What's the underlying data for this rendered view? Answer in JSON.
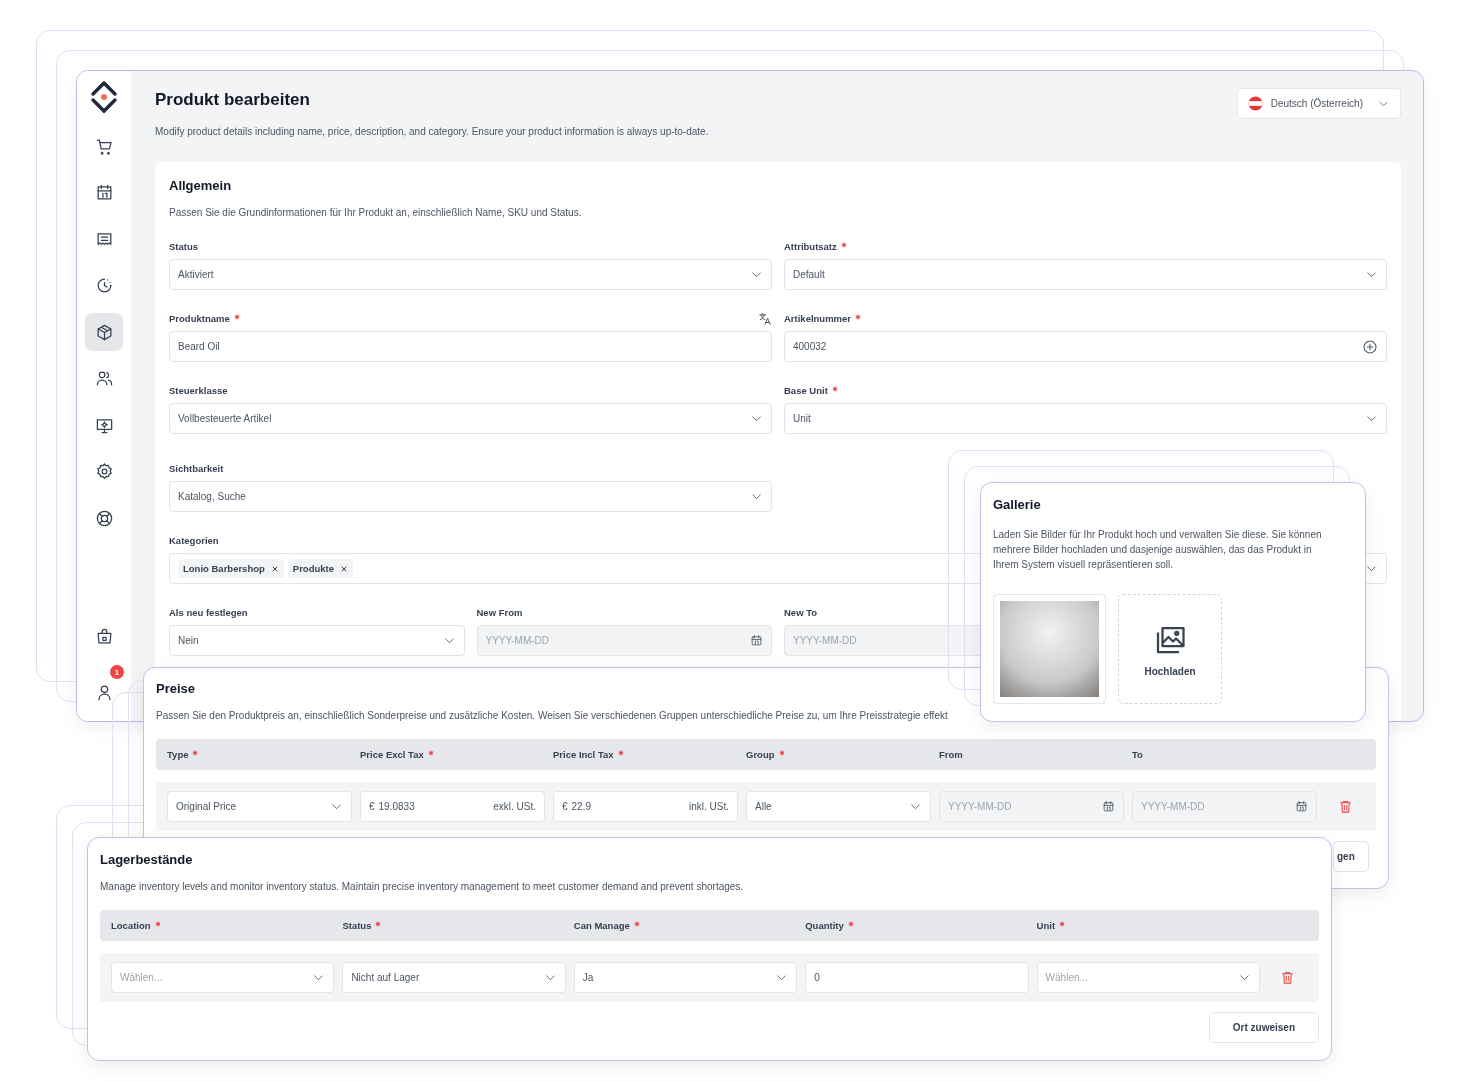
{
  "sidebar": {
    "items": [
      {
        "kind": "cart",
        "selected": false
      },
      {
        "kind": "calendar",
        "selected": false
      },
      {
        "kind": "receipt",
        "selected": false
      },
      {
        "kind": "clock",
        "selected": false
      },
      {
        "kind": "box",
        "selected": true
      },
      {
        "kind": "users",
        "selected": false
      },
      {
        "kind": "monitor",
        "selected": false
      },
      {
        "kind": "gear",
        "selected": false
      },
      {
        "kind": "lifebuoy",
        "selected": false
      }
    ],
    "bottom_items": [
      {
        "kind": "bag",
        "selected": false
      },
      {
        "kind": "user",
        "selected": false,
        "badge": "1"
      }
    ]
  },
  "header": {
    "title": "Produkt bearbeiten",
    "description": "Modify product details including name, price, description, and category. Ensure your product information is always up-to-date.",
    "language": "Deutsch (Österreich)"
  },
  "general": {
    "title": "Allgemein",
    "description": "Passen Sie die Grundinformationen für Ihr Produkt an, einschließlich Name, SKU und Status.",
    "rows": [
      {
        "fields": [
          {
            "label": "Status",
            "required": false,
            "translatable": false,
            "kind": "select",
            "value": "Aktiviert"
          },
          {
            "label": "Attributsatz",
            "required": true,
            "translatable": false,
            "kind": "select",
            "value": "Default"
          }
        ]
      },
      {
        "fields": [
          {
            "label": "Produktname",
            "required": true,
            "translatable": true,
            "kind": "input",
            "value": "Beard Oil"
          },
          {
            "label": "Artikelnummer",
            "required": true,
            "translatable": false,
            "kind": "input-add",
            "value": "400032"
          }
        ]
      },
      {
        "fields": [
          {
            "label": "Steuerklasse",
            "required": false,
            "translatable": false,
            "kind": "select",
            "value": "Vollbesteuerte Artikel"
          },
          {
            "label": "Base Unit",
            "required": true,
            "translatable": false,
            "kind": "select",
            "value": "Unit"
          }
        ]
      },
      {
        "fields": [
          {
            "label": "Sichtbarkeit",
            "required": false,
            "translatable": false,
            "kind": "select",
            "value": "Katalog, Suche"
          }
        ]
      },
      {
        "fields": [
          {
            "label": "Kategorien",
            "required": false,
            "translatable": false,
            "kind": "tags",
            "tags": [
              "Lonio Barbershop",
              "Produkte"
            ]
          }
        ]
      },
      {
        "fields": [
          {
            "label": "Als neu festlegen",
            "required": false,
            "translatable": false,
            "kind": "select",
            "value": "Nein"
          },
          {
            "label": "New From",
            "required": false,
            "translatable": false,
            "kind": "date",
            "placeholder": "YYYY-MM-DD"
          },
          {
            "label": "New To",
            "required": false,
            "translatable": false,
            "kind": "date",
            "placeholder": "YYYY-MM-DD"
          }
        ]
      }
    ]
  },
  "pricing": {
    "title": "Preise",
    "description": "Passen Sie den Produktpreis an, einschließlich Sonderpreise und zusätzliche Kosten. Weisen Sie verschiedenen Gruppen unterschiedliche Preise zu, um Ihre Preisstrategie effekt",
    "columns": [
      {
        "label": "Type",
        "required": true
      },
      {
        "label": "Price Excl Tax",
        "required": true
      },
      {
        "label": "Price Incl Tax",
        "required": true
      },
      {
        "label": "Group",
        "required": true
      },
      {
        "label": "From",
        "required": false
      },
      {
        "label": "To",
        "required": false
      }
    ],
    "rows": [
      {
        "cells": [
          {
            "kind": "select",
            "value": "Original Price"
          },
          {
            "kind": "money",
            "currency": "€",
            "value": "19.0833",
            "suffix": "exkl. USt."
          },
          {
            "kind": "money",
            "currency": "€",
            "value": "22.9",
            "suffix": "inkl. USt."
          },
          {
            "kind": "select",
            "value": "Alle"
          },
          {
            "kind": "date",
            "placeholder": "YYYY-MM-DD"
          },
          {
            "kind": "date",
            "placeholder": "YYYY-MM-DD"
          }
        ]
      }
    ],
    "button": "gen"
  },
  "gallery": {
    "title": "Gallerie",
    "description": "Laden Sie Bilder für Ihr Produkt hoch und verwalten Sie diese. Sie können mehrere Bilder hochladen und dasjenige auswählen, das das Produkt in Ihrem System visuell repräsentieren soll.",
    "items": [
      {
        "kind": "photo"
      },
      {
        "kind": "upload",
        "label": "Hochladen"
      }
    ]
  },
  "inventory": {
    "title": "Lagerbestände",
    "description": "Manage inventory levels and monitor inventory status. Maintain precise inventory management to meet customer demand and prevent shortages.",
    "columns": [
      {
        "label": "Location",
        "required": true
      },
      {
        "label": "Status",
        "required": true
      },
      {
        "label": "Can Manage",
        "required": true
      },
      {
        "label": "Quantity",
        "required": true
      },
      {
        "label": "Unit",
        "required": true
      }
    ],
    "rows": [
      {
        "cells": [
          {
            "kind": "select",
            "placeholder": "Wählen..."
          },
          {
            "kind": "select",
            "value": "Nicht auf Lager"
          },
          {
            "kind": "select",
            "value": "Ja"
          },
          {
            "kind": "input",
            "value": "0"
          },
          {
            "kind": "select",
            "placeholder": "Wählen..."
          }
        ]
      }
    ],
    "button": "Ort zuweisen"
  }
}
